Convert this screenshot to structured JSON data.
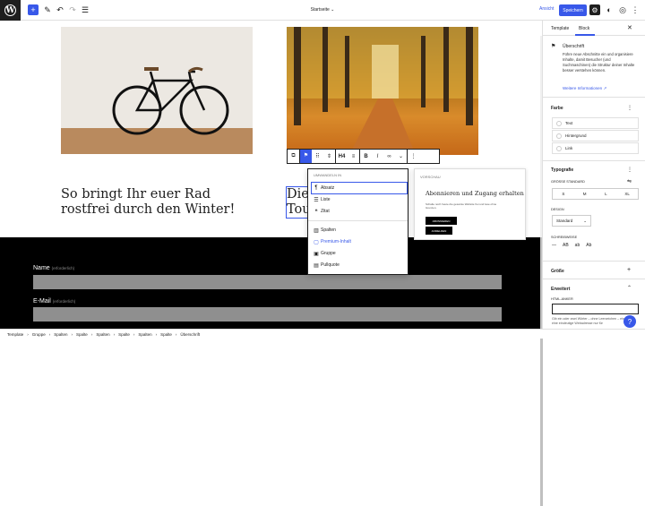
{
  "header": {
    "doc_title": "Startseite",
    "doc_chevron": "⌄",
    "ansicht": "Ansicht",
    "save": "Speichern"
  },
  "canvas": {
    "left_heading": "So bringt Ihr euer Rad rostfrei durch den Winter!",
    "right_heading": "Die\nTou",
    "form": {
      "name_label": "Name",
      "name_req": "(erforderlich)",
      "email_label": "E-Mail",
      "email_req": "(erforderlich)"
    }
  },
  "toolbar": {
    "heading_level": "H4"
  },
  "dropdown": {
    "header": "UMWANDELN IN",
    "items": [
      {
        "icon": "¶",
        "label": "Absatz"
      },
      {
        "icon": "☰",
        "label": "Liste"
      },
      {
        "icon": "❝",
        "label": "Zitat"
      },
      {
        "icon": "▥",
        "label": "Spalten"
      },
      {
        "icon": "▢",
        "label": "Premium-Inhalt"
      },
      {
        "icon": "▣",
        "label": "Gruppe"
      },
      {
        "icon": "▤",
        "label": "Pullquote"
      }
    ]
  },
  "preview": {
    "label": "VORSCHAU",
    "title": "Abonnieren und Zugang erhalten",
    "text": "Schalte noch heute die gesamte Website frei und lese ohne Grenzen.",
    "btn1": "ABONNIEREN",
    "btn2": "ANMELDEN"
  },
  "sidebar": {
    "tab_template": "Template",
    "tab_block": "Block",
    "block_name": "Überschrift",
    "block_desc": "Führe neue Abschnitte ein und organisiere Inhalte, damit Besucher (und Suchmaschinen) die Struktur deiner Inhalte besser verstehen können.",
    "more_info": "Weitere Informationen",
    "color_title": "Farbe",
    "colors": [
      "Text",
      "Hintergrund",
      "Link"
    ],
    "typo_title": "Typografie",
    "size_label": "GRÖSSE STANDARD",
    "sizes": [
      "S",
      "M",
      "L",
      "XL"
    ],
    "design_label": "DESIGN",
    "design_value": "Standard",
    "case_label": "SCHREIBWEISE",
    "case_opts": [
      "—",
      "AB",
      "ab",
      "Ab"
    ],
    "dim_title": "Größe",
    "adv_title": "Erweitert",
    "anchor_label": "HTML-ANKER",
    "anchor_help": "Gib ein oder zwei Wörter – ohne Leerzeichen – ein, um eine eindeutige Webadresse nur für"
  },
  "breadcrumb": [
    "Template",
    "Gruppe",
    "Spalten",
    "Spalte",
    "Spalten",
    "Spalte",
    "Spalten",
    "Spalte",
    "Überschrift"
  ],
  "colors": {
    "accent": "#3858e9",
    "dark": "#1e1e1e"
  }
}
